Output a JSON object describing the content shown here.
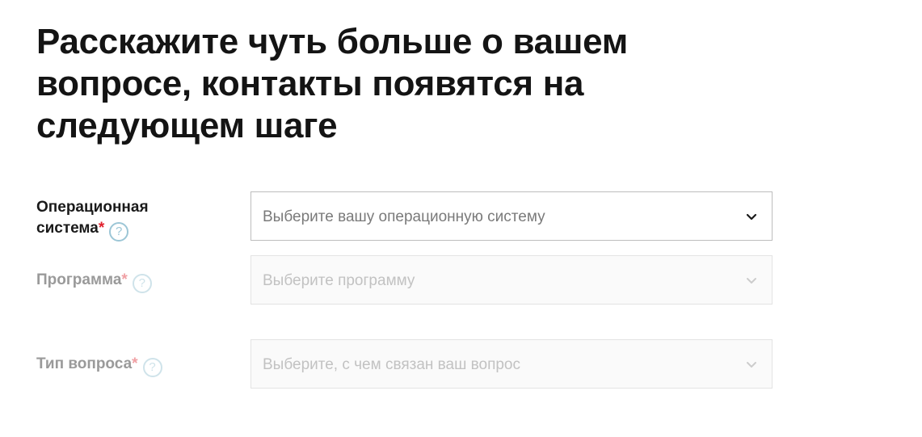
{
  "page_title": "Расскажите чуть больше о вашем вопросе, контакты появятся на следующем шаге",
  "form": {
    "os": {
      "label_line1": "Операционная",
      "label_line2": "система",
      "required_mark": "*",
      "help_icon": "?",
      "placeholder": "Выберите вашу операционную систему",
      "state": "enabled"
    },
    "program": {
      "label": "Программа",
      "required_mark": "*",
      "help_icon": "?",
      "placeholder": "Выберите программу",
      "state": "disabled"
    },
    "question_type": {
      "label": "Тип вопроса",
      "required_mark": "*",
      "help_icon": "?",
      "placeholder": "Выберите, с чем связан ваш вопрос",
      "state": "disabled"
    }
  },
  "icons": {
    "help": "question-circle-icon",
    "dropdown": "chevron-down-icon"
  },
  "colors": {
    "required": "#e0202c",
    "help_icon": "#9cc6d6",
    "text": "#1a1a1a",
    "disabled_text": "#9a9a9a",
    "border": "#bdbdbd"
  }
}
